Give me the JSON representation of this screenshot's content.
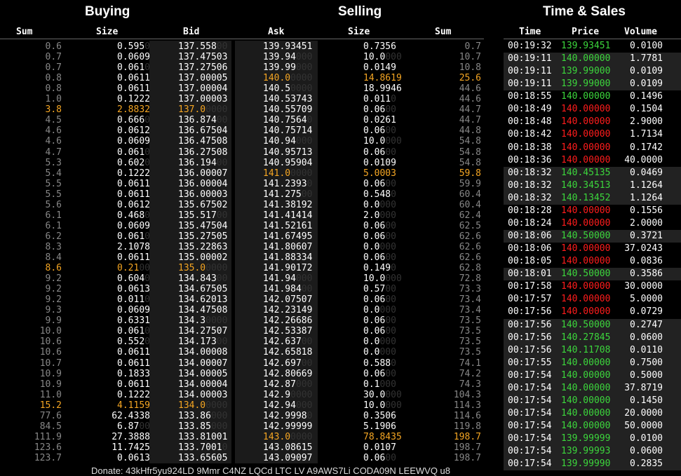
{
  "headers": {
    "buying": "Buying",
    "selling": "Selling",
    "time_sales": "Time & Sales"
  },
  "columns": {
    "sum": "Sum",
    "size": "Size",
    "bid": "Bid",
    "ask": "Ask",
    "size2": "Size",
    "sum2": "Sum",
    "time": "Time",
    "price": "Price",
    "volume": "Volume"
  },
  "bids": [
    [
      "0.6",
      "0.595",
      "0",
      "137.558",
      "00"
    ],
    [
      "0.7",
      "0.0609",
      "",
      "137.47503",
      ""
    ],
    [
      "0.7",
      "0.061",
      "0",
      "137.27506",
      ""
    ],
    [
      "0.8",
      "0.0611",
      "",
      "137.00005",
      ""
    ],
    [
      "0.8",
      "0.0611",
      "",
      "137.00004",
      ""
    ],
    [
      "1.0",
      "0.1222",
      "",
      "137.00003",
      ""
    ],
    [
      "3.8",
      "2.8832",
      "",
      "137.0",
      "0000"
    ],
    [
      "4.5",
      "0.666",
      "0",
      "136.874",
      "00"
    ],
    [
      "4.6",
      "0.0612",
      "",
      "136.67504",
      ""
    ],
    [
      "4.6",
      "0.0609",
      "",
      "136.47508",
      ""
    ],
    [
      "4.7",
      "0.061",
      "0",
      "136.27508",
      ""
    ],
    [
      "5.3",
      "0.602",
      "0",
      "136.194",
      "00"
    ],
    [
      "5.4",
      "0.1222",
      "",
      "136.00007",
      ""
    ],
    [
      "5.5",
      "0.0611",
      "",
      "136.00004",
      ""
    ],
    [
      "5.5",
      "0.0611",
      "",
      "136.00003",
      ""
    ],
    [
      "5.6",
      "0.0612",
      "",
      "135.67502",
      ""
    ],
    [
      "6.1",
      "0.468",
      "0",
      "135.517",
      "00"
    ],
    [
      "6.1",
      "0.0609",
      "",
      "135.47504",
      ""
    ],
    [
      "6.2",
      "0.061",
      "0",
      "135.27505",
      ""
    ],
    [
      "8.3",
      "2.1078",
      "",
      "135.22863",
      ""
    ],
    [
      "8.4",
      "0.0611",
      "",
      "135.00002",
      ""
    ],
    [
      "8.6",
      "0.21",
      "00",
      "135.0",
      "0000"
    ],
    [
      "9.2",
      "0.604",
      "0",
      "134.843",
      "00"
    ],
    [
      "9.2",
      "0.0613",
      "",
      "134.67505",
      ""
    ],
    [
      "9.2",
      "0.011",
      "0",
      "134.62013",
      ""
    ],
    [
      "9.3",
      "0.0609",
      "",
      "134.47508",
      ""
    ],
    [
      "9.9",
      "0.6331",
      "",
      "134.3",
      "0000"
    ],
    [
      "10.0",
      "0.061",
      "0",
      "134.27507",
      ""
    ],
    [
      "10.6",
      "0.552",
      "0",
      "134.173",
      "00"
    ],
    [
      "10.6",
      "0.0611",
      "",
      "134.00008",
      ""
    ],
    [
      "10.7",
      "0.0611",
      "",
      "134.00007",
      ""
    ],
    [
      "10.9",
      "0.1833",
      "",
      "134.00005",
      ""
    ],
    [
      "10.9",
      "0.0611",
      "",
      "134.00004",
      ""
    ],
    [
      "11.0",
      "0.1222",
      "",
      "134.00003",
      ""
    ],
    [
      "15.2",
      "4.1159",
      "",
      "134.0",
      "0000"
    ],
    [
      "77.6",
      "62.4338",
      "",
      "133.86",
      "000"
    ],
    [
      "84.5",
      "6.87",
      "00",
      "133.85",
      "000"
    ],
    [
      "111.9",
      "27.3888",
      "",
      "133.81001",
      ""
    ],
    [
      "123.6",
      "11.7425",
      "",
      "133.7001",
      "0"
    ],
    [
      "123.7",
      "0.0613",
      "",
      "133.65605",
      ""
    ]
  ],
  "bid_highlight_rows": [
    6,
    21,
    34
  ],
  "asks": [
    [
      "139.93451",
      "",
      "0.7356",
      "",
      "0.7"
    ],
    [
      "139.94",
      "000",
      "10.0",
      "000",
      "10.7"
    ],
    [
      "139.99",
      "000",
      "0.0149",
      "",
      "10.8"
    ],
    [
      "140.0",
      "0000",
      "14.8619",
      "",
      "25.6"
    ],
    [
      "140.5",
      "0000",
      "18.9946",
      "",
      "44.6"
    ],
    [
      "140.53743",
      "",
      "0.011",
      "0",
      "44.6"
    ],
    [
      "140.55709",
      "",
      "0.06",
      "00",
      "44.7"
    ],
    [
      "140.7564",
      "0",
      "0.0261",
      "",
      "44.7"
    ],
    [
      "140.75714",
      "",
      "0.06",
      "00",
      "44.8"
    ],
    [
      "140.94",
      "000",
      "10.0",
      "000",
      "54.8"
    ],
    [
      "140.95713",
      "",
      "0.06",
      "00",
      "54.8"
    ],
    [
      "140.95904",
      "",
      "0.0109",
      "",
      "54.8"
    ],
    [
      "141.0",
      "0000",
      "5.0003",
      "",
      "59.8"
    ],
    [
      "141.2393",
      "0",
      "0.06",
      "00",
      "59.9"
    ],
    [
      "141.275",
      "00",
      "0.548",
      "0",
      "60.4"
    ],
    [
      "141.38192",
      "",
      "0.0",
      "000",
      "60.4"
    ],
    [
      "141.41414",
      "",
      "2.0",
      "000",
      "62.4"
    ],
    [
      "141.52161",
      "",
      "0.06",
      "00",
      "62.5"
    ],
    [
      "141.67495",
      "",
      "0.06",
      "00",
      "62.6"
    ],
    [
      "141.80607",
      "",
      "0.0",
      "000",
      "62.6"
    ],
    [
      "141.88334",
      "",
      "0.06",
      "00",
      "62.6"
    ],
    [
      "141.90172",
      "",
      "0.149",
      "0",
      "62.8"
    ],
    [
      "141.94",
      "000",
      "10.0",
      "000",
      "72.8"
    ],
    [
      "141.984",
      "00",
      "0.57",
      "00",
      "73.3"
    ],
    [
      "142.07507",
      "",
      "0.06",
      "00",
      "73.4"
    ],
    [
      "142.23149",
      "",
      "0.0",
      "000",
      "73.4"
    ],
    [
      "142.26686",
      "",
      "0.06",
      "00",
      "73.5"
    ],
    [
      "142.53387",
      "",
      "0.06",
      "00",
      "73.5"
    ],
    [
      "142.637",
      "00",
      "0.0",
      "000",
      "73.5"
    ],
    [
      "142.65818",
      "",
      "0.0",
      "000",
      "73.5"
    ],
    [
      "142.697",
      "00",
      "0.588",
      "0",
      "74.1"
    ],
    [
      "142.80669",
      "",
      "0.06",
      "00",
      "74.2"
    ],
    [
      "142.87",
      "000",
      "0.1",
      "000",
      "74.3"
    ],
    [
      "142.9",
      "0000",
      "30.0",
      "000",
      "104.3"
    ],
    [
      "142.94",
      "000",
      "10.0",
      "000",
      "114.3"
    ],
    [
      "142.9998",
      "0",
      "0.3506",
      "",
      "114.6"
    ],
    [
      "142.99999",
      "",
      "5.1906",
      "",
      "119.8"
    ],
    [
      "143.0",
      "0000",
      "78.8435",
      "",
      "198.7"
    ],
    [
      "143.08615",
      "",
      "0.0107",
      "",
      "198.7"
    ],
    [
      "143.09097",
      "",
      "0.06",
      "00",
      "198.7"
    ]
  ],
  "ask_highlight_rows": [
    3,
    12,
    37
  ],
  "trades": [
    [
      "00:19:32",
      "139.93451",
      "0.0100",
      "up"
    ],
    [
      "00:19:11",
      "140.00000",
      "1.7781",
      "up"
    ],
    [
      "00:19:11",
      "139.99000",
      "0.0109",
      "up"
    ],
    [
      "00:19:11",
      "139.99000",
      "0.0109",
      "up"
    ],
    [
      "00:18:55",
      "140.00000",
      "0.1496",
      "up"
    ],
    [
      "00:18:49",
      "140.00000",
      "0.1504",
      "down"
    ],
    [
      "00:18:48",
      "140.00000",
      "2.9000",
      "down"
    ],
    [
      "00:18:42",
      "140.00000",
      "1.7134",
      "down"
    ],
    [
      "00:18:38",
      "140.00000",
      "0.1742",
      "down"
    ],
    [
      "00:18:36",
      "140.00000",
      "40.0000",
      "down"
    ],
    [
      "00:18:32",
      "140.45135",
      "0.0469",
      "up"
    ],
    [
      "00:18:32",
      "140.34513",
      "1.1264",
      "up"
    ],
    [
      "00:18:32",
      "140.13452",
      "1.1264",
      "up"
    ],
    [
      "00:18:28",
      "140.00000",
      "0.1556",
      "down"
    ],
    [
      "00:18:24",
      "140.00000",
      "2.0000",
      "down"
    ],
    [
      "00:18:06",
      "140.50000",
      "0.3721",
      "up"
    ],
    [
      "00:18:06",
      "140.00000",
      "37.0243",
      "down"
    ],
    [
      "00:18:05",
      "140.00000",
      "0.0836",
      "down"
    ],
    [
      "00:18:01",
      "140.50000",
      "0.3586",
      "up"
    ],
    [
      "00:17:58",
      "140.00000",
      "30.0000",
      "down"
    ],
    [
      "00:17:57",
      "140.00000",
      "5.0000",
      "down"
    ],
    [
      "00:17:56",
      "140.00000",
      "0.0729",
      "down"
    ],
    [
      "00:17:56",
      "140.50000",
      "0.2747",
      "up"
    ],
    [
      "00:17:56",
      "140.27845",
      "0.0600",
      "up"
    ],
    [
      "00:17:56",
      "140.11708",
      "0.0110",
      "up"
    ],
    [
      "00:17:55",
      "140.00000",
      "0.7500",
      "up"
    ],
    [
      "00:17:54",
      "140.00000",
      "0.5000",
      "up"
    ],
    [
      "00:17:54",
      "140.00000",
      "37.8719",
      "up"
    ],
    [
      "00:17:54",
      "140.00000",
      "0.1450",
      "up"
    ],
    [
      "00:17:54",
      "140.00000",
      "20.0000",
      "up"
    ],
    [
      "00:17:54",
      "140.00000",
      "50.0000",
      "up"
    ],
    [
      "00:17:54",
      "139.99999",
      "0.0100",
      "up"
    ],
    [
      "00:17:54",
      "139.99993",
      "0.0600",
      "up"
    ],
    [
      "00:17:54",
      "139.99990",
      "0.2835",
      "up"
    ]
  ],
  "trade_alt_rows": [
    1,
    2,
    3,
    10,
    11,
    12,
    15,
    18,
    22,
    23,
    24,
    25,
    26,
    27,
    28,
    29,
    30,
    31,
    32,
    33
  ],
  "colors": {
    "up": "#3cd63c",
    "down": "#ff1c1c",
    "highlight": "#f5a623",
    "background": "#000000"
  },
  "footer": "Donate: 43kHfr5yu924LD 9Mmr C4NZ LQCd LTC LV A9AWS7Li CODA09N LEEWVQ u8"
}
